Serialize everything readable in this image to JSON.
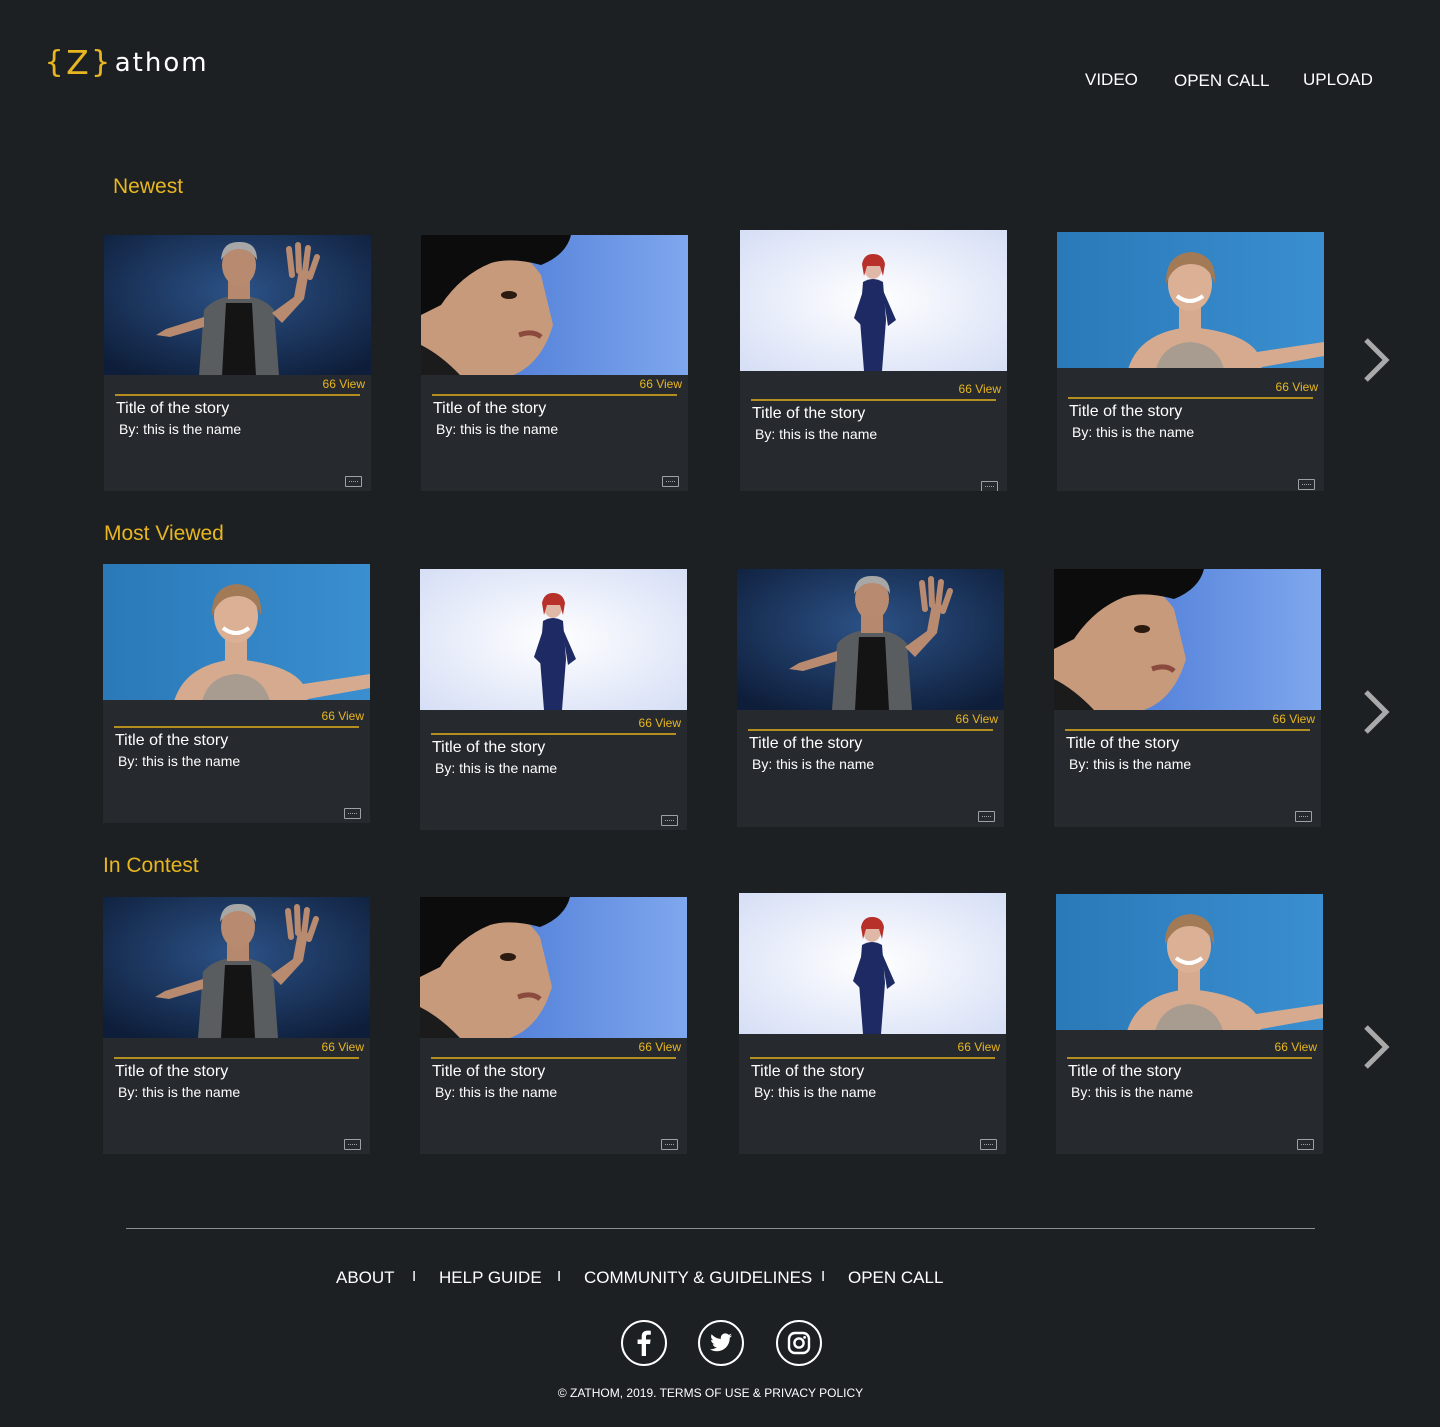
{
  "brand": {
    "open_brace": "{",
    "letter": "Z",
    "close_brace": "}",
    "word": "athom"
  },
  "nav": {
    "video": "VIDEO",
    "open_call": "OPEN CALL",
    "upload": "UPLOAD"
  },
  "sections": [
    {
      "title": "Newest",
      "cards": [
        {
          "thumb": "man-gesturing",
          "views": "66 View",
          "title": "Title of the story",
          "byline": "By: this is the name"
        },
        {
          "thumb": "young-man-closeup",
          "views": "66 View",
          "title": "Title of the story",
          "byline": "By: this is the name"
        },
        {
          "thumb": "woman-standing-white",
          "views": "66 View",
          "title": "Title of the story",
          "byline": "By: this is the name"
        },
        {
          "thumb": "woman-smiling-blue",
          "views": "66 View",
          "title": "Title of the story",
          "byline": "By: this is the name"
        }
      ]
    },
    {
      "title": "Most Viewed",
      "cards": [
        {
          "thumb": "woman-smiling-blue",
          "views": "66 View",
          "title": "Title of the story",
          "byline": "By: this is the name"
        },
        {
          "thumb": "woman-standing-white",
          "views": "66 View",
          "title": "Title of the story",
          "byline": "By: this is the name"
        },
        {
          "thumb": "man-gesturing",
          "views": "66 View",
          "title": "Title of the story",
          "byline": "By: this is the name"
        },
        {
          "thumb": "young-man-closeup",
          "views": "66 View",
          "title": "Title of the story",
          "byline": "By: this is the name"
        }
      ]
    },
    {
      "title": "In Contest",
      "cards": [
        {
          "thumb": "man-gesturing",
          "views": "66 View",
          "title": "Title of the story",
          "byline": "By: this is the name"
        },
        {
          "thumb": "young-man-closeup",
          "views": "66 View",
          "title": "Title of the story",
          "byline": "By: this is the name"
        },
        {
          "thumb": "woman-standing-white",
          "views": "66 View",
          "title": "Title of the story",
          "byline": "By: this is the name"
        },
        {
          "thumb": "woman-smiling-blue",
          "views": "66 View",
          "title": "Title of the story",
          "byline": "By: this is the name"
        }
      ]
    }
  ],
  "card_icon": "closed-caption-icon",
  "arrow_icon": "chevron-right-icon",
  "footer": {
    "links": [
      "ABOUT",
      "HELP GUIDE",
      "COMMUNITY & GUIDELINES",
      "OPEN CALL"
    ],
    "separator": "I",
    "social": [
      "facebook-icon",
      "twitter-icon",
      "instagram-icon"
    ],
    "copyright": "© ZATHOM, 2019. TERMS OF USE & PRIVACY POLICY"
  },
  "colors": {
    "background": "#1d2023",
    "card": "#262a2e",
    "accent": "#e8b621",
    "text": "#ffffff"
  }
}
